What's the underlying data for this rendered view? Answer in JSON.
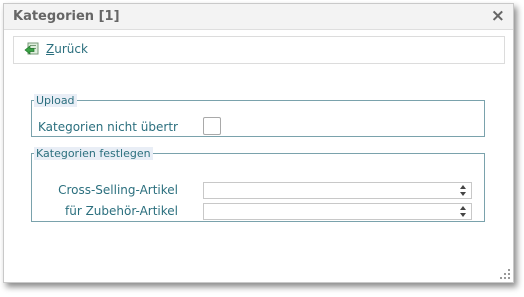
{
  "dialog": {
    "title": "Kategorien [1]",
    "close_label": "×"
  },
  "toolbar": {
    "back_hotkey": "Z",
    "back_rest": "urück"
  },
  "upload": {
    "legend": "Upload",
    "label": "Kategorien nicht übertragen",
    "checked": false
  },
  "categories": {
    "legend": "Kategorien festlegen",
    "cross_selling_label": "Cross-Selling-Artikel",
    "cross_selling_value": "",
    "accessory_label": "für Zubehör-Artikel",
    "accessory_value": ""
  },
  "colors": {
    "accent_text": "#2b6f7e",
    "title_text": "#666666",
    "fieldset_border": "#7aa2ac",
    "legend_bg": "#e9eef6"
  },
  "icons": {
    "back": "back-arrow-icon",
    "close": "close-icon",
    "select_arrows": "updown-arrows-icon",
    "resize": "resize-grip-icon"
  }
}
